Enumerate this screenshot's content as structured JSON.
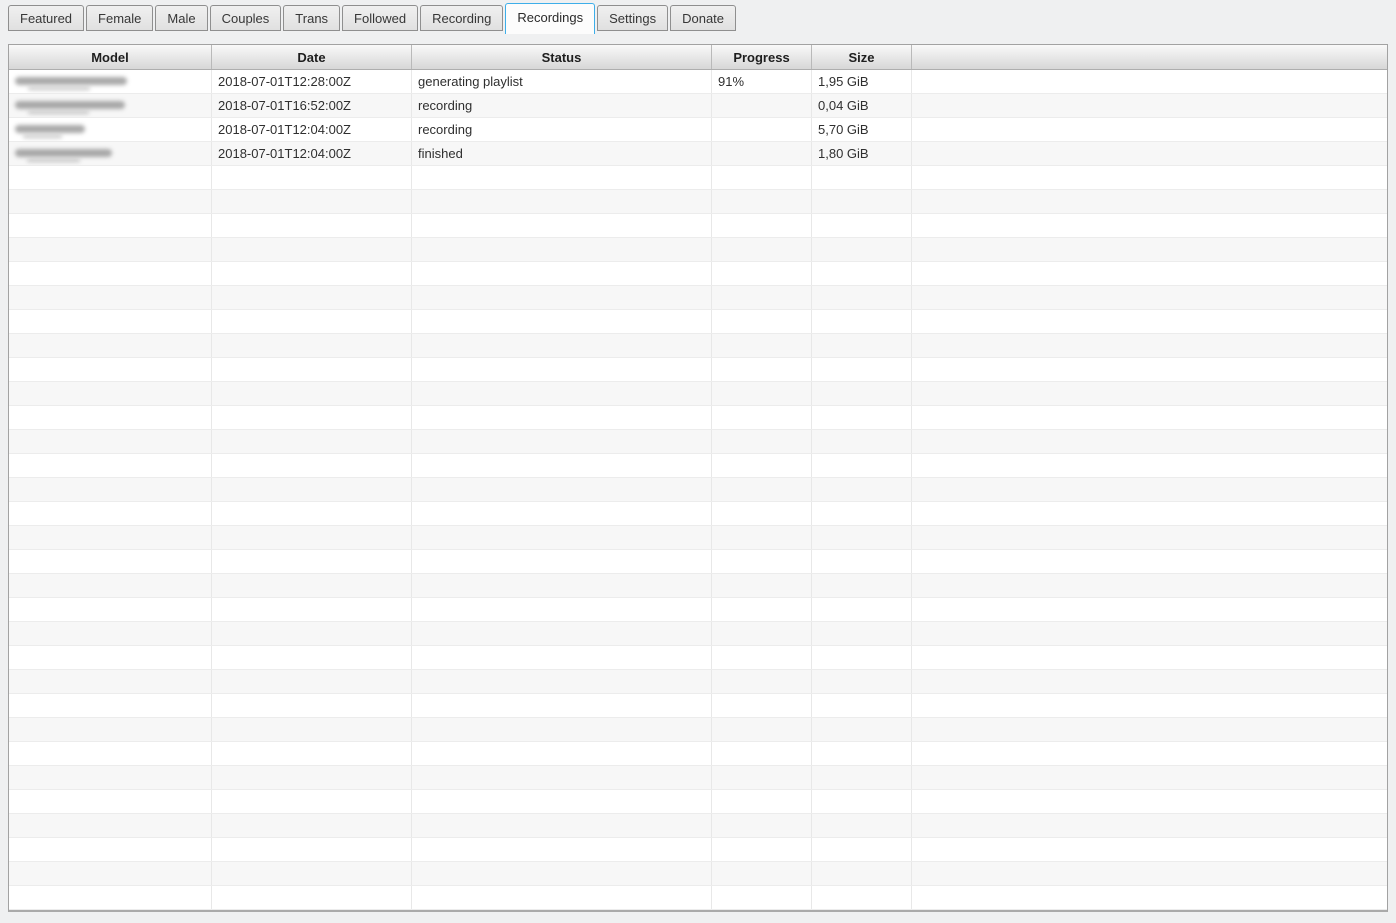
{
  "tabs": {
    "items": [
      {
        "label": "Featured",
        "active": false
      },
      {
        "label": "Female",
        "active": false
      },
      {
        "label": "Male",
        "active": false
      },
      {
        "label": "Couples",
        "active": false
      },
      {
        "label": "Trans",
        "active": false
      },
      {
        "label": "Followed",
        "active": false
      },
      {
        "label": "Recording",
        "active": false
      },
      {
        "label": "Recordings",
        "active": true
      },
      {
        "label": "Settings",
        "active": false
      },
      {
        "label": "Donate",
        "active": false
      }
    ]
  },
  "table": {
    "columns": [
      {
        "key": "model",
        "label": "Model"
      },
      {
        "key": "date",
        "label": "Date"
      },
      {
        "key": "status",
        "label": "Status"
      },
      {
        "key": "progress",
        "label": "Progress"
      },
      {
        "key": "size",
        "label": "Size"
      },
      {
        "key": "filler",
        "label": ""
      }
    ],
    "rows": [
      {
        "model_redacted": true,
        "model_blur_width": 112,
        "date": "2018-07-01T12:28:00Z",
        "status": "generating playlist",
        "progress": "91%",
        "size": "1,95 GiB"
      },
      {
        "model_redacted": true,
        "model_blur_width": 110,
        "date": "2018-07-01T16:52:00Z",
        "status": "recording",
        "progress": "",
        "size": "0,04 GiB"
      },
      {
        "model_redacted": true,
        "model_blur_width": 70,
        "date": "2018-07-01T12:04:00Z",
        "status": "recording",
        "progress": "",
        "size": "5,70 GiB"
      },
      {
        "model_redacted": true,
        "model_blur_width": 97,
        "date": "2018-07-01T12:04:00Z",
        "status": "finished",
        "progress": "",
        "size": "1,80 GiB"
      }
    ],
    "empty_row_count": 31
  },
  "colors": {
    "accent": "#3daee9",
    "window_bg": "#eff0f1",
    "row_bg": "#ffffff",
    "row_alt_bg": "#f7f7f7",
    "header_gradient_top": "#f9f9f9",
    "header_gradient_bottom": "#d7d7d7",
    "frame_border": "#a2a2a2"
  }
}
